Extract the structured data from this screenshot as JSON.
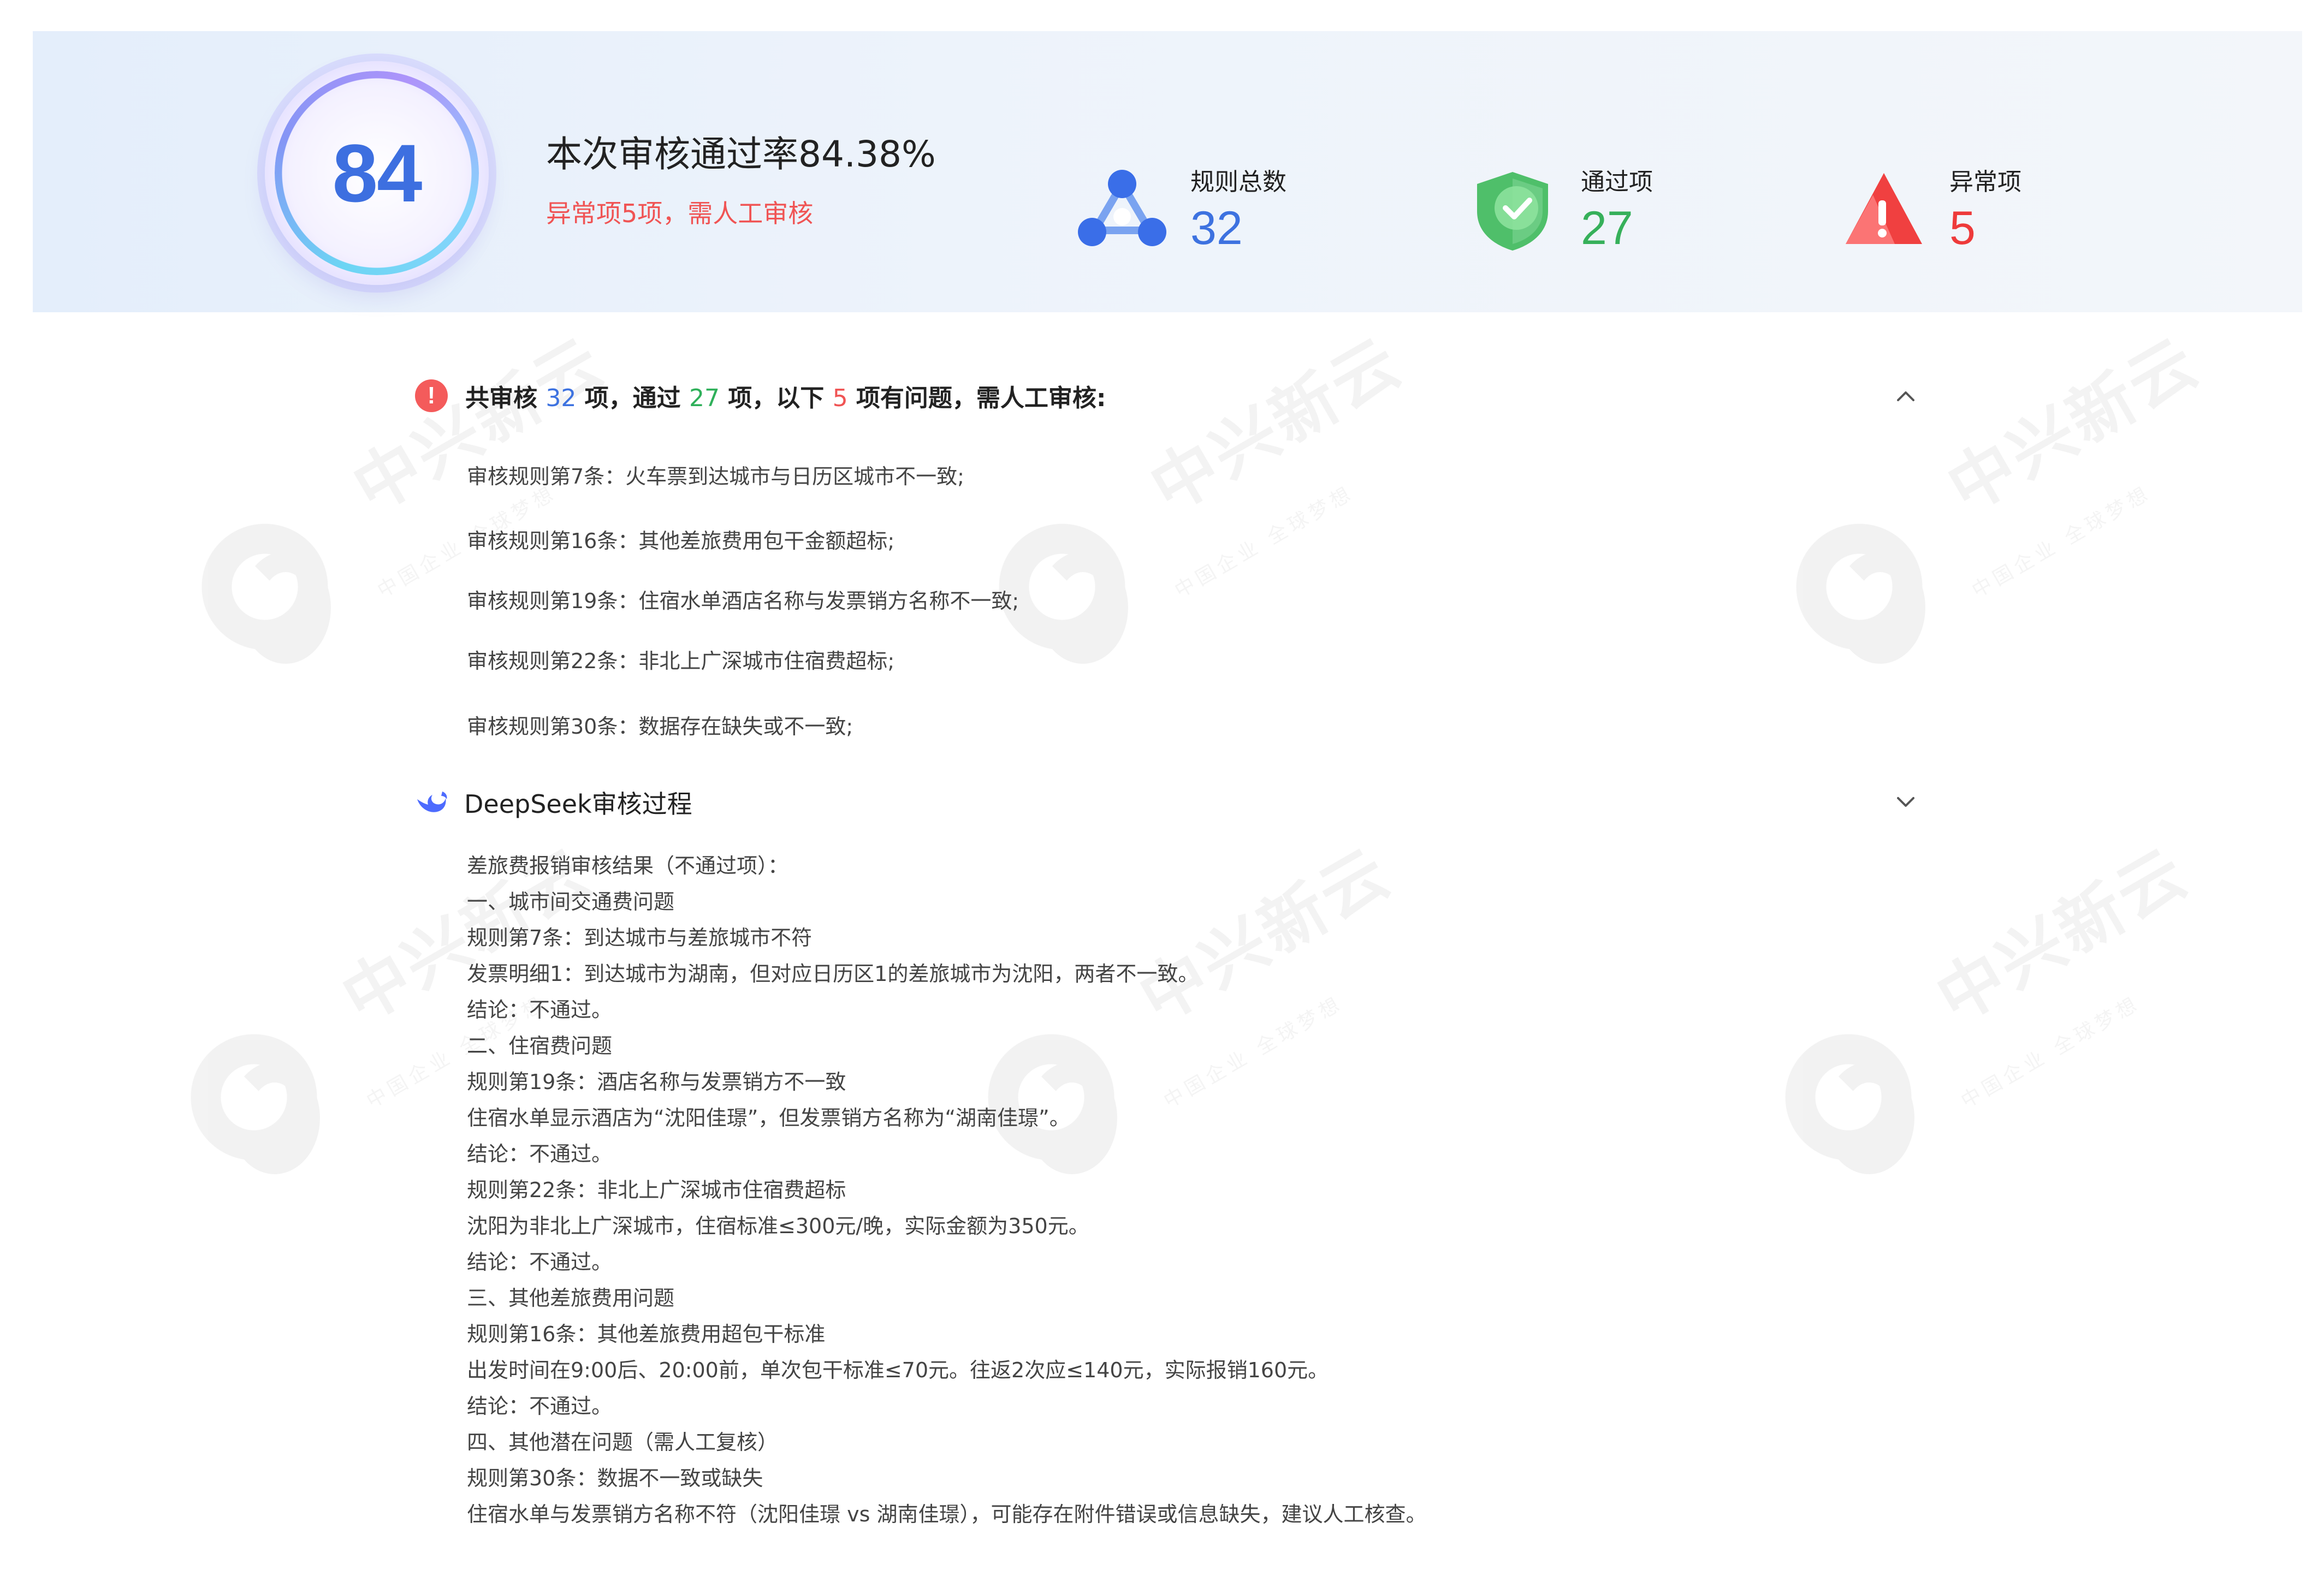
{
  "header": {
    "score": "84",
    "pass_rate_title": "本次审核通过率84.38%",
    "pass_rate_sub": "异常项5项，需人工审核",
    "stats": [
      {
        "label": "规则总数",
        "value": "32",
        "icon": "network-nodes-icon",
        "color": "#3d72e0"
      },
      {
        "label": "通过项",
        "value": "27",
        "icon": "shield-check-icon",
        "color": "#36b05a"
      },
      {
        "label": "异常项",
        "value": "5",
        "icon": "warning-triangle-icon",
        "color": "#ee3a3a"
      }
    ]
  },
  "summary": {
    "part1": "共审核 ",
    "total": "32",
    "part2": " 项，通过 ",
    "passed": "27",
    "part3": " 项，以下 ",
    "issues": "5",
    "part4": " 项有问题，需人工审核:",
    "items": [
      "审核规则第7条：火车票到达城市与日历区城市不一致;",
      "审核规则第16条：其他差旅费用包干金额超标;",
      "审核规则第19条：住宿水单酒店名称与发票销方名称不一致;",
      "审核规则第22条：非北上广深城市住宿费超标;",
      "审核规则第30条：数据存在缺失或不一致;"
    ]
  },
  "process": {
    "title": "DeepSeek审核过程",
    "lines": [
      "差旅费报销审核结果（不通过项）：",
      "一、城市间交通费问题",
      "规则第7条：到达城市与差旅城市不符",
      "发票明细1：到达城市为湖南，但对应日历区1的差旅城市为沈阳，两者不一致。",
      "结论：不通过。",
      "二、住宿费问题",
      "规则第19条：酒店名称与发票销方不一致",
      "住宿水单显示酒店为“沈阳佳璟”，但发票销方名称为“湖南佳璟”。",
      "结论：不通过。",
      "规则第22条：非北上广深城市住宿费超标",
      "沈阳为非北上广深城市，住宿标准≤300元/晚，实际金额为350元。",
      "结论：不通过。",
      "三、其他差旅费用问题",
      "规则第16条：其他差旅费用超包干标准",
      "出发时间在9:00后、20:00前，单次包干标准≤70元。往返2次应≤140元，实际报销160元。",
      "结论：不通过。",
      "四、其他潜在问题（需人工复核）",
      "规则第30条：数据不一致或缺失",
      "住宿水单与发票销方名称不符（沈阳佳璟 vs 湖南佳璟），可能存在附件错误或信息缺失，建议人工核查。"
    ]
  },
  "watermark": {
    "brand": "中兴新云",
    "slogan": "中国企业 全球梦想"
  }
}
